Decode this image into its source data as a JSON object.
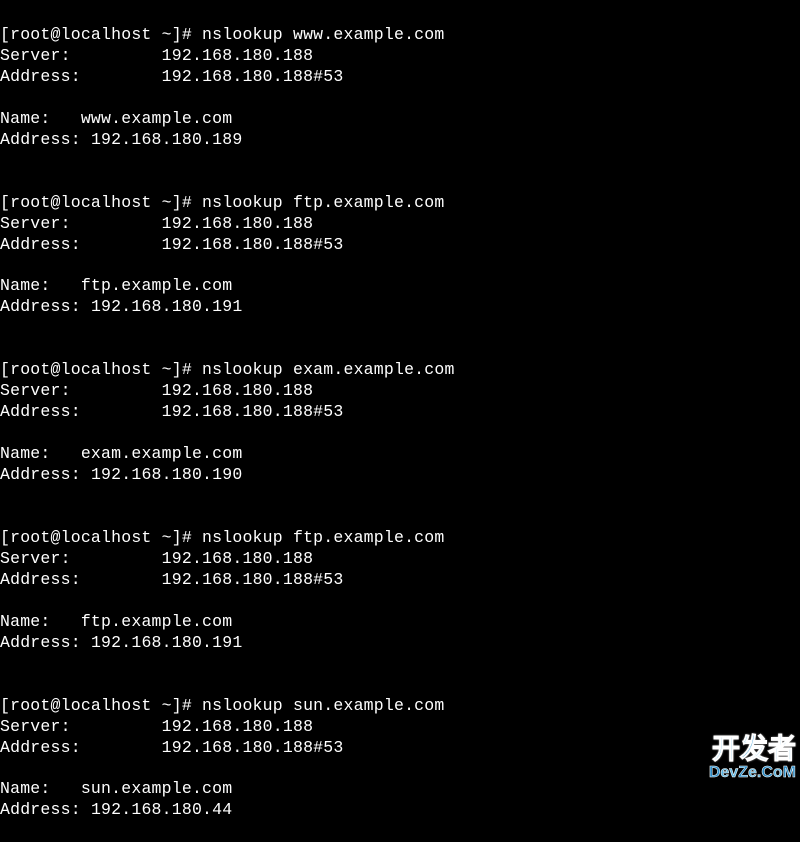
{
  "prompt_prefix": "[root@localhost ~]# ",
  "server_label": "Server:",
  "address_label": "Address:",
  "name_label": "Name:",
  "result_address_label": "Address:",
  "dns_server_ip": "192.168.180.188",
  "dns_server_address": "192.168.180.188#53",
  "lookups": [
    {
      "command": "nslookup www.example.com",
      "name": "www.example.com",
      "address": "192.168.180.189"
    },
    {
      "command": "nslookup ftp.example.com",
      "name": "ftp.example.com",
      "address": "192.168.180.191"
    },
    {
      "command": "nslookup exam.example.com",
      "name": "exam.example.com",
      "address": "192.168.180.190"
    },
    {
      "command": "nslookup ftp.example.com",
      "name": "ftp.example.com",
      "address": "192.168.180.191"
    },
    {
      "command": "nslookup sun.example.com",
      "name": "sun.example.com",
      "address": "192.168.180.44"
    }
  ],
  "watermark": {
    "cn": "开发者",
    "en": "DevZe.CoM"
  }
}
